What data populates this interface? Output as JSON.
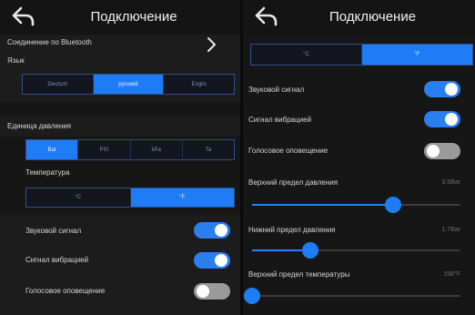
{
  "left": {
    "title": "Подключение",
    "bluetooth_label": "Соединение по Bluetooth",
    "language_label": "Язык",
    "language_options": [
      "Deutsch",
      "русский",
      "Englis"
    ],
    "language_selected": 1,
    "pressure_unit_label": "Единица давления",
    "pressure_units": [
      "Bar",
      "PSI",
      "kPa",
      "Ta"
    ],
    "pressure_unit_selected": 0,
    "temperature_label": "Температура",
    "temperature_options": [
      "°C",
      "°F"
    ],
    "temperature_selected": 1,
    "sound_label": "Звуковой сигнал",
    "sound_on": true,
    "vibration_label": "Сигнал вибрацией",
    "vibration_on": true,
    "voice_label": "Голосовое оповещение",
    "voice_on": false
  },
  "right": {
    "title": "Подключение",
    "temperature_options": [
      "°C",
      "°F"
    ],
    "temperature_selected": 1,
    "sound_label": "Звуковой сигнал",
    "sound_on": true,
    "vibration_label": "Сигнал вибрацией",
    "vibration_on": true,
    "voice_label": "Голосовое оповещение",
    "voice_on": false,
    "upper_pressure_label": "Верхний предел давления",
    "upper_pressure_value": "3.5Bar",
    "upper_pressure_level": 0.68,
    "lower_pressure_label": "Нижний предел давления",
    "lower_pressure_value": "1.7Bar",
    "lower_pressure_level": 0.28,
    "upper_temperature_label": "Верхний предел температуры",
    "upper_temperature_value": "158°F",
    "upper_temperature_level": 0.0
  },
  "colors": {
    "accent": "#1e7cf5",
    "toggle_off": "#9a9a9a",
    "background": "#161616"
  }
}
